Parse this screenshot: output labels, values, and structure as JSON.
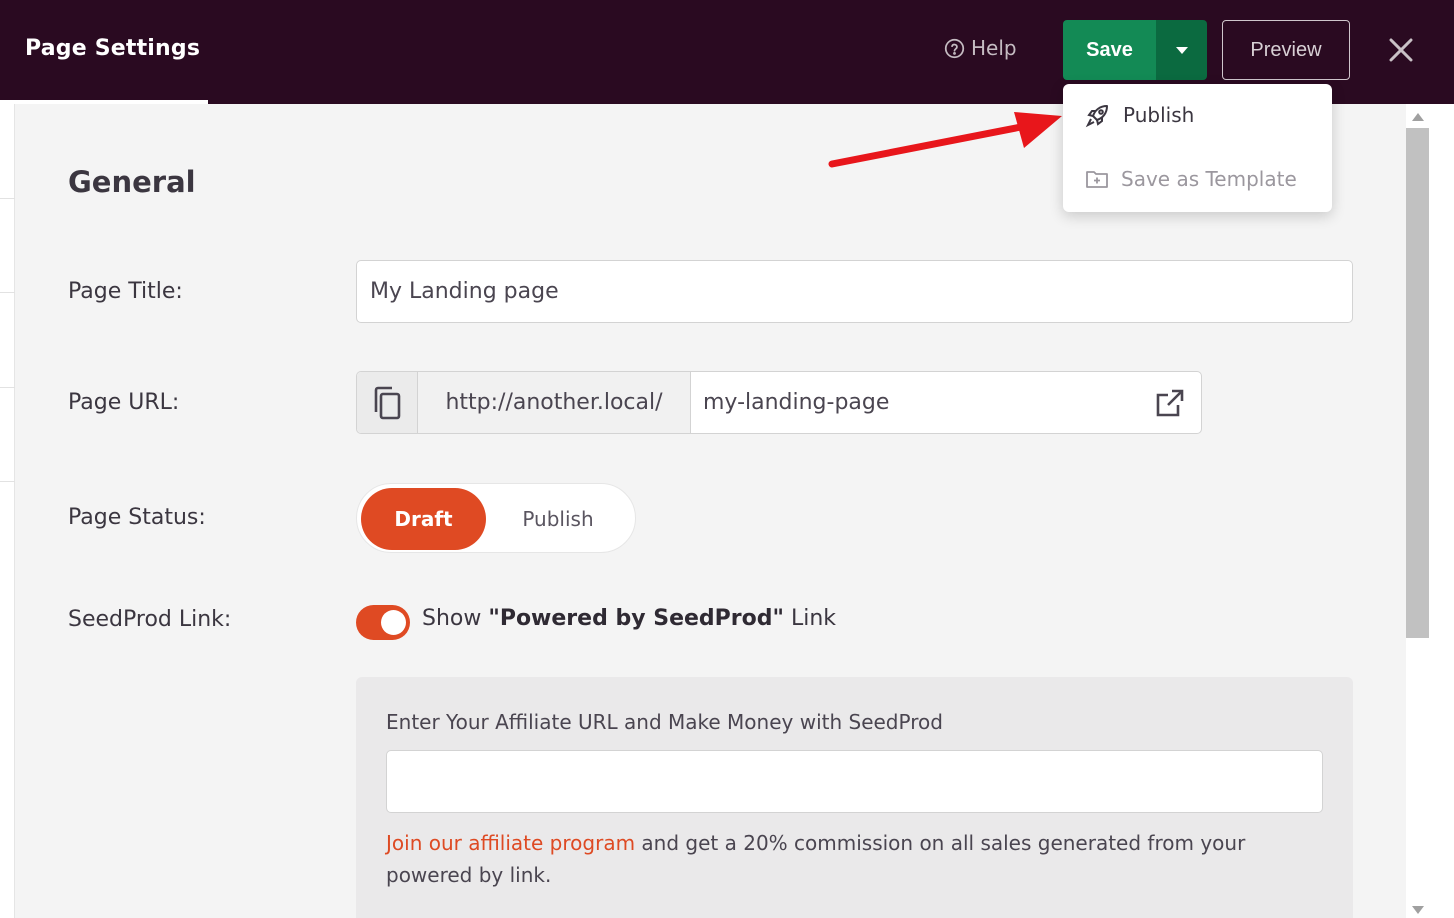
{
  "header": {
    "title": "Page Settings",
    "help_label": "Help",
    "save_label": "Save",
    "preview_label": "Preview"
  },
  "save_menu": {
    "items": [
      {
        "label": "Publish",
        "icon": "rocket-icon"
      },
      {
        "label": "Save as Template",
        "icon": "folder-plus-icon"
      }
    ]
  },
  "general": {
    "section_title": "General",
    "page_title_label": "Page Title:",
    "page_title_value": "My Landing page",
    "page_url_label": "Page URL:",
    "page_url_base": "http://another.local/",
    "page_url_slug": "my-landing-page",
    "page_status_label": "Page Status:",
    "status_draft": "Draft",
    "status_publish": "Publish",
    "seedprod_link_label": "SeedProd Link:",
    "toggle_prefix": "Show ",
    "toggle_bold": "\"Powered by SeedProd\"",
    "toggle_suffix": " Link",
    "affiliate_label": "Enter Your Affiliate URL and Make Money with SeedProd",
    "affiliate_value": "",
    "affiliate_link_text": "Join our affiliate program",
    "affiliate_note": " and get a 20% commission on all sales generated from your powered by link."
  },
  "colors": {
    "topbar": "#2a0a21",
    "save": "#138a55",
    "accent": "#df4a23"
  }
}
